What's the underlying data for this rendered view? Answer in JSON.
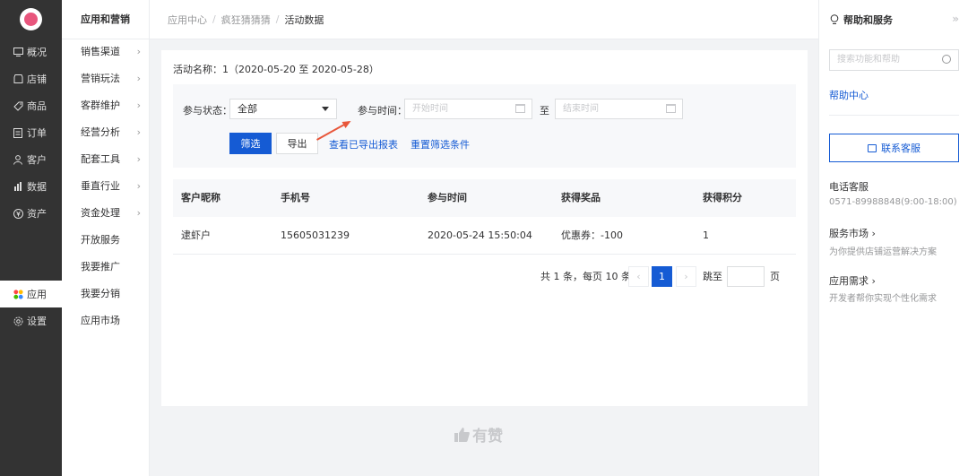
{
  "nav": {
    "items": [
      {
        "label": "概况",
        "icon": "monitor-icon"
      },
      {
        "label": "店铺",
        "icon": "shop-icon"
      },
      {
        "label": "商品",
        "icon": "tag-icon"
      },
      {
        "label": "订单",
        "icon": "order-icon"
      },
      {
        "label": "客户",
        "icon": "user-icon"
      },
      {
        "label": "数据",
        "icon": "chart-icon"
      },
      {
        "label": "资产",
        "icon": "yen-icon"
      },
      {
        "label": "应用",
        "icon": "apps-icon"
      },
      {
        "label": "设置",
        "icon": "gear-icon"
      }
    ],
    "active_index": 7
  },
  "sub": {
    "title": "应用和营销",
    "items": [
      {
        "label": "销售渠道",
        "has_children": true
      },
      {
        "label": "营销玩法",
        "has_children": true
      },
      {
        "label": "客群维护",
        "has_children": true
      },
      {
        "label": "经营分析",
        "has_children": true
      },
      {
        "label": "配套工具",
        "has_children": true
      },
      {
        "label": "垂直行业",
        "has_children": true
      },
      {
        "label": "资金处理",
        "has_children": true
      },
      {
        "label": "开放服务",
        "has_children": false
      },
      {
        "label": "我要推广",
        "has_children": false
      },
      {
        "label": "我要分销",
        "has_children": false
      },
      {
        "label": "应用市场",
        "has_children": false
      }
    ]
  },
  "breadcrumb": {
    "items": [
      "应用中心",
      "疯狂猜猜猜",
      "活动数据"
    ],
    "separator": "/"
  },
  "activity": {
    "name_line": "活动名称：1（2020-05-20 至 2020-05-28）"
  },
  "filter": {
    "status_label": "参与状态：",
    "status_value": "全部",
    "time_label": "参与时间：",
    "start_placeholder": "开始时间",
    "to_label": "至",
    "end_placeholder": "结束时间",
    "filter_button": "筛选",
    "export_button": "导出",
    "view_exported_link": "查看已导出报表",
    "reset_link": "重置筛选条件"
  },
  "table": {
    "headers": [
      "客户昵称",
      "手机号",
      "参与时间",
      "获得奖品",
      "获得积分"
    ],
    "rows": [
      [
        "逮虾户",
        "15605031239",
        "2020-05-24 15:50:04",
        "优惠券：-100",
        "1"
      ]
    ]
  },
  "pager": {
    "summary": "共 1 条，每页 10 条",
    "current_page": "1",
    "jump_label": "跳至",
    "page_suffix": "页",
    "prev_glyph": "‹",
    "next_glyph": "›"
  },
  "footer": {
    "brand": "有赞"
  },
  "help": {
    "title": "帮助和服务",
    "collapse_glyph": "»",
    "search_placeholder": "搜索功能和帮助",
    "help_center_link": "帮助中心",
    "contact_button": "联系客服",
    "phone_title": "电话客服",
    "phone_value": "0571-89988848(9:00-18:00)",
    "market_title": "服务市场",
    "market_desc": "为你提供店铺运营解决方案",
    "demand_title": "应用需求",
    "demand_desc": "开发者帮你实现个性化需求",
    "chevron": "›"
  },
  "colors": {
    "primary": "#155bd4",
    "nav_bg": "#333333",
    "annotation_arrow": "#e8563a"
  }
}
